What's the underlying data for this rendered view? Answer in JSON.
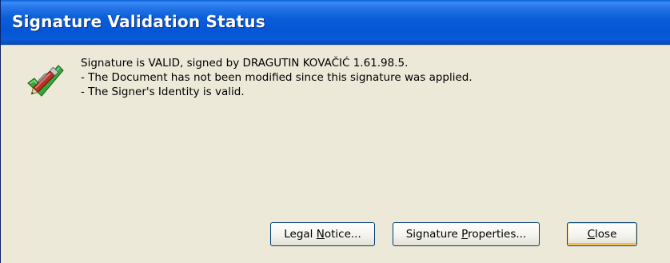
{
  "window": {
    "title": "Signature Validation Status"
  },
  "status": {
    "icon": "valid-signature-pen-checkmark-icon",
    "lines": [
      "Signature is VALID, signed by DRAGUTIN KOVAČIĆ 1.61.98.5.",
      "- The Document has not been modified since this signature was applied.",
      "- The Signer's Identity is valid."
    ]
  },
  "buttons": {
    "legal_notice": {
      "before": "Legal ",
      "mnemonic": "N",
      "after": "otice..."
    },
    "signature_properties": {
      "before": "Signature ",
      "mnemonic": "P",
      "after": "roperties..."
    },
    "close": {
      "before": "",
      "mnemonic": "C",
      "after": "lose"
    }
  },
  "colors": {
    "titlebar": "#0a5ed8",
    "dialog_background": "#ece9d8",
    "button_border": "#003c74",
    "check_green": "#3aa63a"
  }
}
